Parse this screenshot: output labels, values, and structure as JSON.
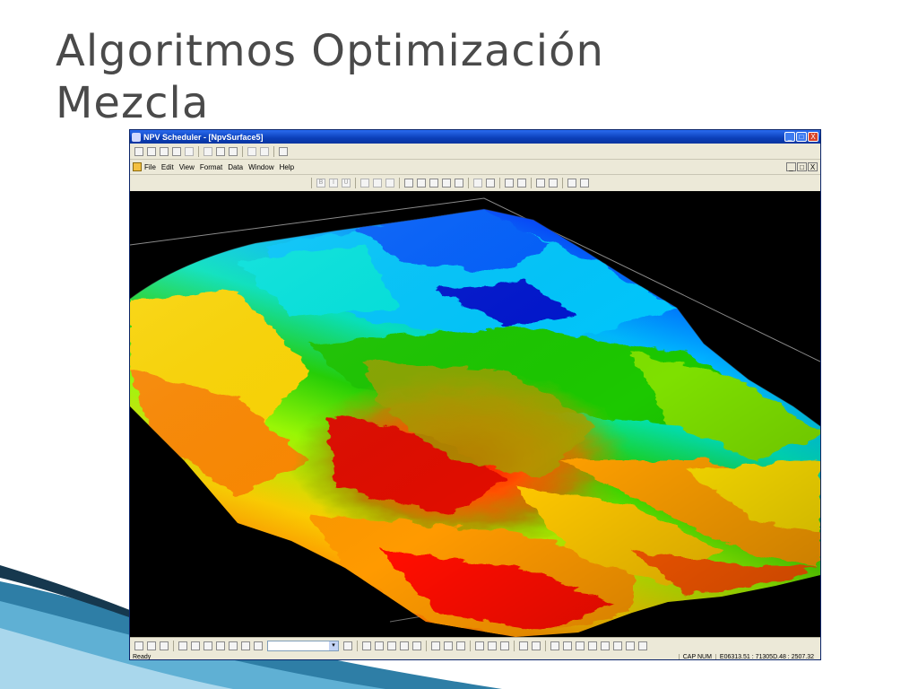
{
  "slide": {
    "title_line1": "Algoritmos Optimización",
    "title_line2": "Mezcla"
  },
  "window": {
    "title": "NPV Scheduler - [NpvSurface5]",
    "title_buttons": [
      "_",
      "□",
      "X"
    ],
    "mdi_buttons": [
      "_",
      "□",
      "X"
    ],
    "menu": [
      "File",
      "Edit",
      "View",
      "Format",
      "Data",
      "Window",
      "Help"
    ],
    "toolbar_top_icons": [
      "new-icon",
      "open-icon",
      "save-icon",
      "print-icon",
      "print-preview-icon",
      "cut-icon",
      "copy-icon",
      "paste-icon",
      "undo-icon",
      "redo-icon",
      "help-icon"
    ],
    "toolbar_format_labels": [
      "B",
      "I",
      "U"
    ],
    "status": {
      "ready": "Ready",
      "mode": "CAP NUM",
      "coords": "E06313.51 : 71305D.48 : 2507.32"
    }
  },
  "surface": {
    "colors": [
      "#ff0000",
      "#ff6a00",
      "#ffb000",
      "#ffee00",
      "#b8ff00",
      "#2ad000",
      "#00e0a0",
      "#00e8ff",
      "#00a8ff",
      "#0050ff",
      "#0010c8"
    ]
  }
}
